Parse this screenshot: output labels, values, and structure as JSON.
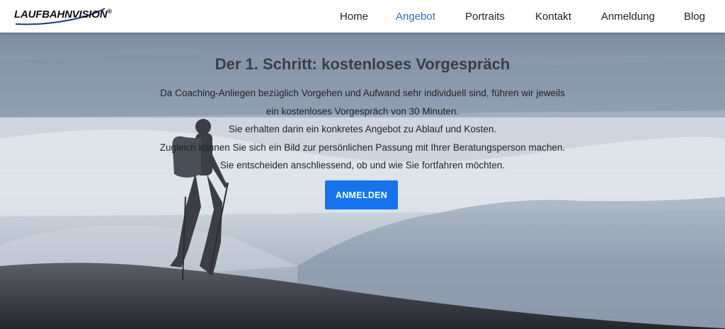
{
  "header": {
    "logo_text": "LAUFBAHNVISION",
    "logo_mark": "®",
    "nav": [
      {
        "label": "Home",
        "active": false
      },
      {
        "label": "Angebot",
        "active": true
      },
      {
        "label": "Portraits",
        "active": false
      },
      {
        "label": "Kontakt",
        "active": false
      },
      {
        "label": "Anmeldung",
        "active": false
      },
      {
        "label": "Blog",
        "active": false
      }
    ]
  },
  "hero": {
    "title": "Der 1. Schritt: kostenloses Vorgespräch",
    "lines": [
      "Da Coaching-Anliegen bezüglich Vorgehen und Aufwand sehr individuell sind, führen wir jeweils",
      "ein kostenloses Vorgespräch von 30 Minuten.",
      "Sie erhalten darin ein konkretes Angebot zu Ablauf und Kosten.",
      "Zugleich können Sie sich ein Bild zur persönlichen Passung mit Ihrer Beratungsperson machen.",
      "Sie entscheiden anschliessend, ob und wie Sie fortfahren möchten."
    ],
    "button_label": "ANMELDEN"
  },
  "colors": {
    "accent": "#1673ee",
    "active_nav": "#2a6fdb"
  }
}
